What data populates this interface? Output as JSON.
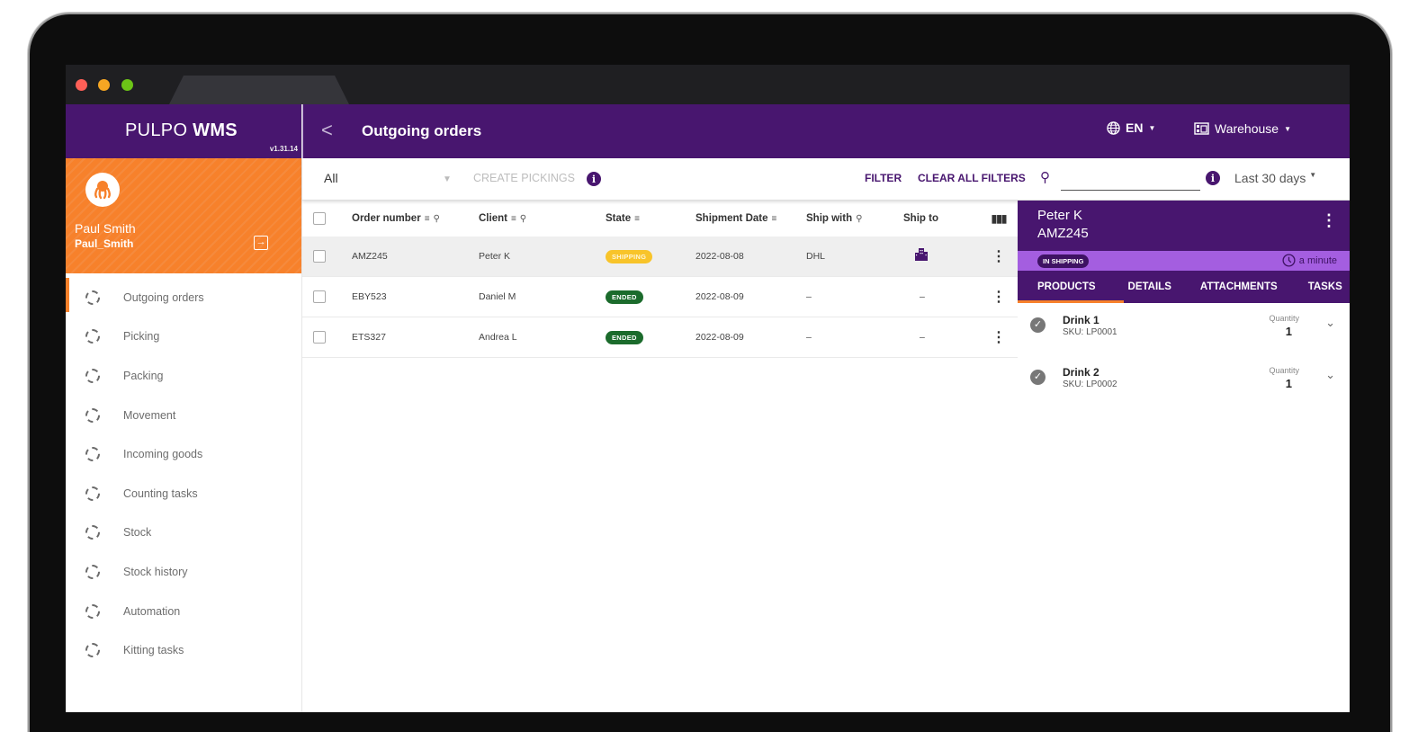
{
  "window": {
    "controls": [
      "close",
      "minimize",
      "maximize"
    ]
  },
  "brand": {
    "name_light": "PULPO",
    "name_bold": "WMS",
    "version": "v1.31.14"
  },
  "user": {
    "display_name": "Paul Smith",
    "login": "Paul_Smith",
    "avatar_icon": "octopus-icon",
    "logout_icon": "logout-icon"
  },
  "sidebar": {
    "items": [
      {
        "label": "Outgoing orders",
        "active": true
      },
      {
        "label": "Picking"
      },
      {
        "label": "Packing"
      },
      {
        "label": "Movement"
      },
      {
        "label": "Incoming goods"
      },
      {
        "label": "Counting tasks"
      },
      {
        "label": "Stock"
      },
      {
        "label": "Stock history"
      },
      {
        "label": "Automation"
      },
      {
        "label": "Kitting tasks"
      }
    ]
  },
  "header": {
    "back_icon": "chevron-left-icon",
    "title": "Outgoing orders",
    "language": "EN",
    "warehouse": "Warehouse"
  },
  "toolbar": {
    "select_value": "All",
    "create_pickings": "CREATE PICKINGS",
    "filter": "FILTER",
    "clear_filters": "CLEAR ALL FILTERS",
    "search_value": "",
    "search_placeholder": "",
    "date_range": "Last 30 days"
  },
  "table": {
    "columns": [
      "Order number",
      "Client",
      "State",
      "Shipment Date",
      "Ship with",
      "Ship to"
    ],
    "rows": [
      {
        "order": "AMZ245",
        "client": "Peter K",
        "state": "SHIPPING",
        "date": "2022-08-08",
        "ship_with": "DHL",
        "ship_to": "building-icon",
        "selected": true
      },
      {
        "order": "EBY523",
        "client": "Daniel M",
        "state": "ENDED",
        "date": "2022-08-09",
        "ship_with": "–",
        "ship_to": "–"
      },
      {
        "order": "ETS327",
        "client": "Andrea L",
        "state": "ENDED",
        "date": "2022-08-09",
        "ship_with": "–",
        "ship_to": "–"
      }
    ]
  },
  "detail": {
    "client": "Peter K",
    "order": "AMZ245",
    "status": "IN SHIPPING",
    "time": "a minute",
    "tabs": [
      "PRODUCTS",
      "DETAILS",
      "ATTACHMENTS",
      "TASKS"
    ],
    "active_tab": "PRODUCTS",
    "quantity_label": "Quantity",
    "products": [
      {
        "name": "Drink 1",
        "sku": "SKU: LP0001",
        "quantity": "1"
      },
      {
        "name": "Drink 2",
        "sku": "SKU: LP0002",
        "quantity": "1"
      }
    ]
  },
  "colors": {
    "primary": "#48166f",
    "accent": "#f7812b",
    "shipping": "#f8c42a",
    "ended": "#1b6b2c",
    "status_bar": "#a45ee0"
  }
}
